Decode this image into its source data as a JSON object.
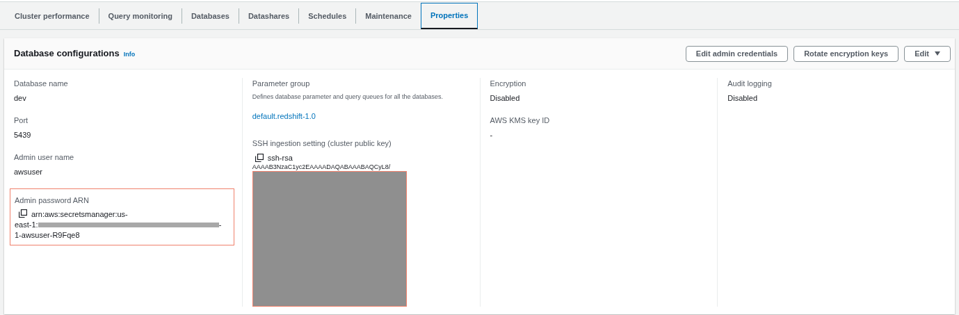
{
  "tabs": [
    {
      "label": "Cluster performance",
      "selected": false
    },
    {
      "label": "Query monitoring",
      "selected": false
    },
    {
      "label": "Databases",
      "selected": false
    },
    {
      "label": "Datashares",
      "selected": false
    },
    {
      "label": "Schedules",
      "selected": false
    },
    {
      "label": "Maintenance",
      "selected": false
    },
    {
      "label": "Properties",
      "selected": true
    }
  ],
  "panel": {
    "title": "Database configurations",
    "info": "Info",
    "buttons": [
      {
        "label": "Edit admin credentials",
        "kind": "plain"
      },
      {
        "label": "Rotate encryption keys",
        "kind": "plain"
      },
      {
        "label": "Edit",
        "kind": "dropdown"
      }
    ],
    "columns": [
      [
        {
          "label": "Database name",
          "value": "dev",
          "kind": "text"
        },
        {
          "label": "Port",
          "value": "5439",
          "kind": "text"
        },
        {
          "label": "Admin user name",
          "value": "awsuser",
          "kind": "text"
        },
        {
          "label": "Admin password ARN",
          "lines": [
            "arn:aws:secretsmanager:us-",
            "east-1:",
            "-",
            "1-awsuser-R9Fqe8"
          ],
          "kind": "arn",
          "highlighted": true
        }
      ],
      [
        {
          "label": "Parameter group",
          "description": "Defines database parameter and query queues for all the databases.",
          "value": "default.redshift-1.0",
          "kind": "link"
        },
        {
          "label": "SSH ingestion setting (cluster public key)",
          "lines": [
            "ssh-rsa",
            "AAAAB3NzaC1yc2EAAAADAQABAAABAQCyL8/"
          ],
          "kind": "key",
          "highlighted": true
        }
      ],
      [
        {
          "label": "Encryption",
          "value": "Disabled",
          "kind": "text"
        },
        {
          "label": "AWS KMS key ID",
          "value": "-",
          "kind": "text"
        }
      ],
      [
        {
          "label": "Audit logging",
          "value": "Disabled",
          "kind": "text"
        }
      ]
    ]
  }
}
